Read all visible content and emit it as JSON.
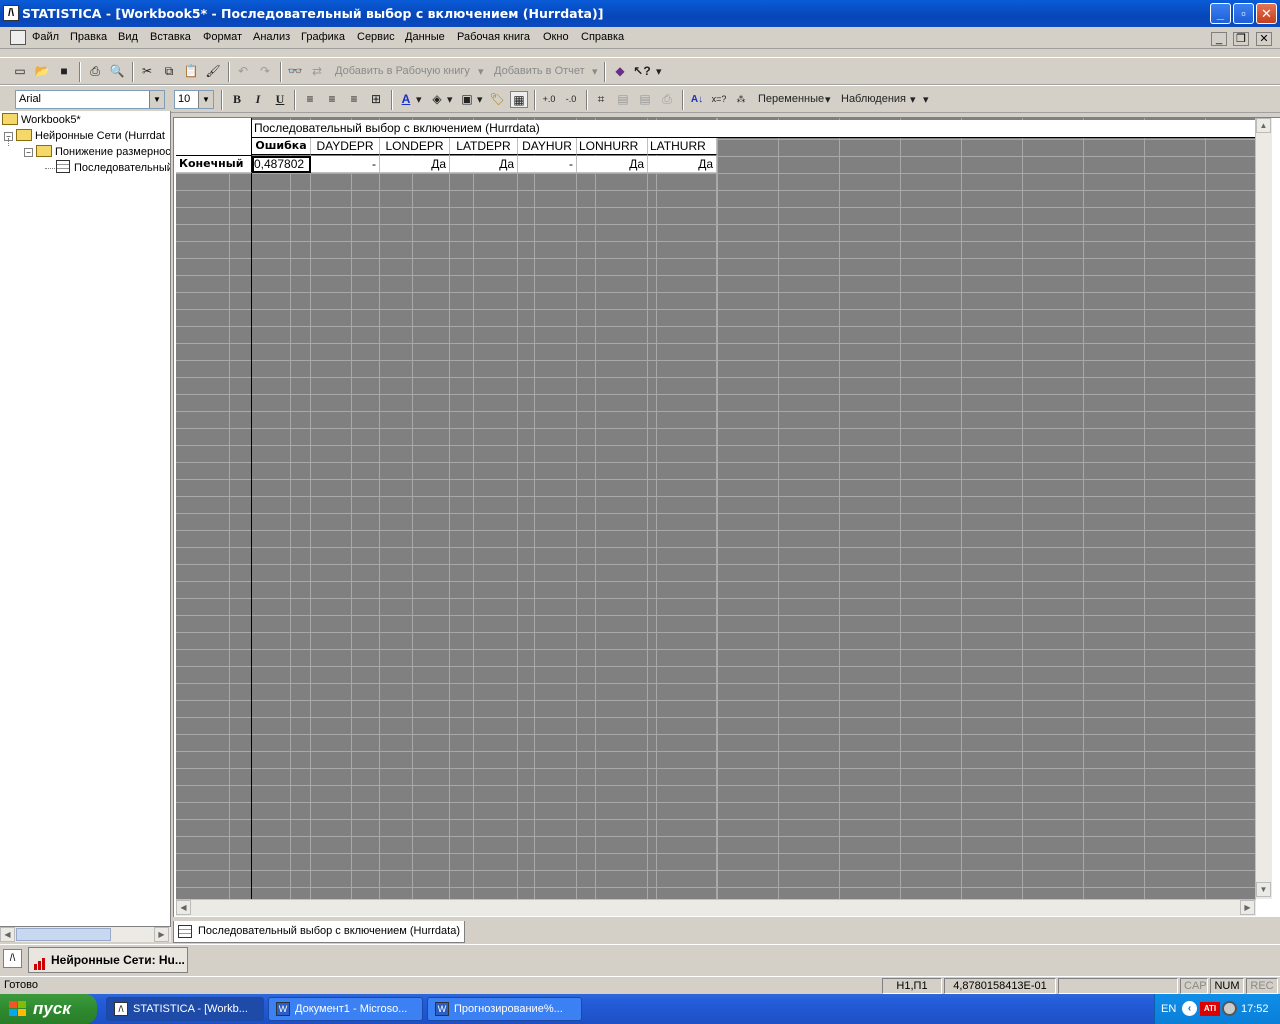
{
  "window": {
    "title": "STATISTICA - [Workbook5* - Последовательный выбор с включением (Hurrdata)]",
    "app_icon_glyph": "/\\",
    "buttons": {
      "minimize": "_",
      "maximize": "▫",
      "close": "✕"
    }
  },
  "menu": {
    "items": [
      "Файл",
      "Правка",
      "Вид",
      "Вставка",
      "Формат",
      "Анализ",
      "Графика",
      "Сервис",
      "Данные",
      "Рабочая книга",
      "Окно",
      "Справка"
    ],
    "mdi_buttons": {
      "minimize": "_",
      "restore": "❐",
      "close": "✕"
    }
  },
  "toolbar1": {
    "add_to_workbook": "Добавить в Рабочую книгу",
    "add_to_report": "Добавить в Отчет"
  },
  "toolbar2": {
    "font_name": "Arial",
    "font_size": "10",
    "bold": "B",
    "italic": "I",
    "underline": "U",
    "variables": "Переменные",
    "cases": "Наблюдения"
  },
  "tree": {
    "nodes": [
      {
        "label": "Workbook5*",
        "icon": "folder-icon"
      },
      {
        "label": "Нейронные Сети (Hurrdat",
        "icon": "folder-icon"
      },
      {
        "label": "Понижение размерност",
        "icon": "folder-icon"
      },
      {
        "label": "Последовательный",
        "icon": "spreadsheet-icon"
      }
    ]
  },
  "spreadsheet": {
    "title": "Последовательный выбор с включением (Hurrdata)",
    "columns": [
      "Ошибка",
      "DAYDEPR",
      "LONDEPR",
      "LATDEPR",
      "DAYHUR",
      "LONHURR",
      "LATHURR"
    ],
    "rows": [
      {
        "header": "Конечный",
        "cells": [
          "0,487802",
          "-",
          "Да",
          "Да",
          "-",
          "Да",
          "Да"
        ]
      }
    ]
  },
  "sheet_tab": {
    "label": "Последовательный выбор с включением (Hurrdata)"
  },
  "mdi_task": {
    "label": "Нейронные Сети: Hu..."
  },
  "status": {
    "ready": "Готово",
    "cell_ref": "Н1,П1",
    "cell_value": "4,8780158413E-01",
    "cap": "CAP",
    "num": "NUM",
    "rec": "REC"
  },
  "taskbar": {
    "start": "пуск",
    "tasks": [
      "STATISTICA - [Workb...",
      "Документ1 - Microso...",
      "Прогнозирование%..."
    ],
    "lang": "EN",
    "ati": "ATI",
    "clock": "17:52"
  },
  "colors": {
    "titlebar": "#0a5cd8",
    "grid_empty": "#808080",
    "taskbar": "#245edb",
    "start": "#3c9a3c"
  }
}
